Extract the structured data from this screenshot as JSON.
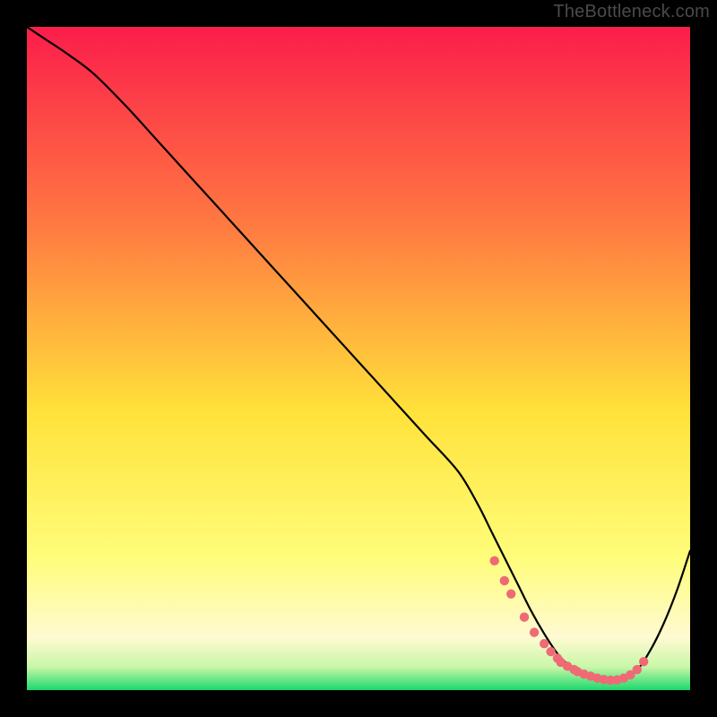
{
  "watermark": "TheBottleneck.com",
  "colors": {
    "bg": "#000000",
    "grad_top": "#fb1d4b",
    "grad_mid1": "#ff7a41",
    "grad_mid2": "#ffe23a",
    "grad_low": "#fffad2",
    "grad_bottom": "#1bd96c",
    "curve": "#000000",
    "marker_fill": "#ef6a74",
    "marker_stroke": "#ef6a74"
  },
  "chart_data": {
    "type": "line",
    "title": "",
    "xlabel": "",
    "ylabel": "",
    "xlim": [
      0,
      100
    ],
    "ylim": [
      0,
      100
    ],
    "series": [
      {
        "name": "bottleneck-curve",
        "x": [
          0,
          3,
          6,
          10,
          15,
          20,
          25,
          30,
          35,
          40,
          45,
          50,
          55,
          60,
          65,
          68,
          70,
          72,
          74,
          76,
          78,
          80,
          82,
          84,
          86,
          88,
          90,
          92,
          94,
          96,
          98,
          100
        ],
        "y": [
          100,
          98,
          96,
          93,
          88,
          82.5,
          77,
          71.5,
          66,
          60.5,
          55,
          49.5,
          44,
          38.5,
          33,
          28,
          24,
          20,
          16,
          12,
          8.5,
          5.5,
          3.5,
          2.3,
          1.7,
          1.5,
          1.8,
          3,
          6,
          10,
          15,
          21
        ]
      }
    ],
    "markers": {
      "name": "highlighted-points",
      "x": [
        70.5,
        72,
        73,
        75,
        76.5,
        78,
        79,
        80,
        80.5,
        81.5,
        82.5,
        83,
        84,
        85,
        86,
        87,
        88,
        89,
        90,
        91,
        92,
        93
      ],
      "y": [
        19.5,
        16.5,
        14.5,
        11,
        8.7,
        7,
        5.8,
        4.8,
        4.2,
        3.6,
        3.1,
        2.8,
        2.4,
        2.1,
        1.8,
        1.6,
        1.5,
        1.55,
        1.8,
        2.3,
        3.1,
        4.3
      ]
    },
    "gradient_stops": [
      {
        "offset": 0.0,
        "color": "#fb1d4b"
      },
      {
        "offset": 0.3,
        "color": "#ff7a41"
      },
      {
        "offset": 0.58,
        "color": "#ffe23a"
      },
      {
        "offset": 0.8,
        "color": "#fffd7a"
      },
      {
        "offset": 0.92,
        "color": "#fffad2"
      },
      {
        "offset": 0.965,
        "color": "#c9f7a8"
      },
      {
        "offset": 1.0,
        "color": "#1bd96c"
      }
    ]
  }
}
